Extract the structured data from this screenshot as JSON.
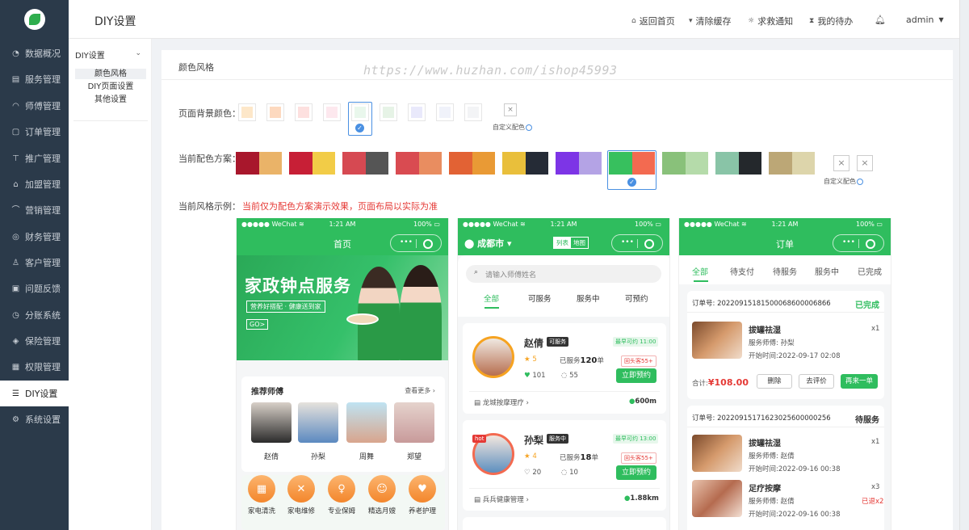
{
  "app": {
    "title": "DIY设置"
  },
  "header": {
    "links": [
      "返回首页",
      "清除缓存",
      "求救通知",
      "我的待办"
    ],
    "user": "admin",
    "dropdown_icon": "caret-down"
  },
  "sidebar": {
    "items": [
      "数据概况",
      "服务管理",
      "师傅管理",
      "订单管理",
      "推广管理",
      "加盟管理",
      "营销管理",
      "财务管理",
      "客户管理",
      "问题反馈",
      "分账系统",
      "保险管理",
      "权限管理",
      "DIY设置",
      "系统设置"
    ],
    "active": "DIY设置"
  },
  "subnav": {
    "head": "DIY设置",
    "items": [
      "颜色风格",
      "DIY页面设置",
      "其他设置"
    ],
    "active": "颜色风格"
  },
  "main": {
    "section_title": "颜色风格",
    "watermark": "https://www.huzhan.com/ishop45993",
    "bg_label": "页面背景颜色：",
    "bg_colors": [
      "#fde7c9",
      "#fdd9bf",
      "#fde0df",
      "#fde8ee",
      "#e9f7ec",
      "#e6f3e6",
      "#e9e9fb",
      "#f0f2fa",
      "#f3f4f6"
    ],
    "bg_selected_index": 4,
    "custom_label": "自定义配色",
    "scheme_label": "当前配色方案：",
    "schemes": [
      [
        "#a8172c",
        "#eab368"
      ],
      [
        "#c71f36",
        "#f2cc47"
      ],
      [
        "#d64952",
        "#555"
      ],
      [
        "#d94b51",
        "#e98d60"
      ],
      [
        "#e26234",
        "#e99a35"
      ],
      [
        "#e9bf3b",
        "#252b36"
      ],
      [
        "#7d35e6",
        "#b4a3e5"
      ],
      [
        "#37c05e",
        "#f36a50"
      ],
      [
        "#89c17a",
        "#b5dbaa"
      ],
      [
        "#89c4a7",
        "#24282c"
      ],
      [
        "#bca776",
        "#ddd5ab"
      ]
    ],
    "scheme_selected_index": 7,
    "example_label": "当前风格示例：",
    "example_note": "当前仅为配色方案演示效果，页面布局以实际为准"
  },
  "phone1": {
    "status_left": "WeChat",
    "time": "1:21 AM",
    "battery": "100%",
    "title": "首页",
    "banner_title": "家政钟点服务",
    "banner_sub": "营养好搭配 · 健康送到家",
    "banner_go": "GO>",
    "rec_title": "推荐师傅",
    "rec_more": "查看更多",
    "masters": [
      "赵倩",
      "孙梨",
      "周舞",
      "郑望"
    ],
    "categories": [
      "家电清洗",
      "家电维修",
      "专业保姆",
      "精选月嫂",
      "养老护理"
    ]
  },
  "phone2": {
    "status_left": "WeChat",
    "time": "1:21 AM",
    "battery": "100%",
    "city": "成都市",
    "toggle": [
      "列表",
      "地图"
    ],
    "search_placeholder": "请输入师傅姓名",
    "tabs": [
      "全部",
      "可服务",
      "服务中",
      "可预约"
    ],
    "masters": [
      {
        "name": "赵倩",
        "status": "可服务",
        "earliest": "最早可约 11:00",
        "rating": "5",
        "served_pre": "已服务",
        "served": "120",
        "unit": "单",
        "repeat": "回头客55+",
        "likes": "101",
        "comments": "55",
        "btn": "立即预约",
        "shop": "龙城按摩理疗",
        "dist": "600m"
      },
      {
        "name": "孙梨",
        "status": "服务中",
        "earliest": "最早可约 13:00",
        "rating": "4",
        "served_pre": "已服务",
        "served": "18",
        "unit": "单",
        "repeat": "回头客55+",
        "likes": "20",
        "comments": "10",
        "btn": "立即预约",
        "shop": "兵兵健康管理",
        "dist": "1.88km",
        "tag": "hot"
      }
    ]
  },
  "phone3": {
    "status_left": "WeChat",
    "time": "1:21 AM",
    "battery": "100%",
    "title": "订单",
    "tabs": [
      "全部",
      "待支付",
      "待服务",
      "服务中",
      "已完成"
    ],
    "orders": [
      {
        "no": "订单号: 20220915181500068600006866",
        "state": "已完成",
        "items": [
          {
            "name": "拔罐祛湿",
            "qty": "x1",
            "master_label": "服务师傅:",
            "master": "孙梨",
            "time_label": "开始时间:",
            "time": "2022-09-17 02:08"
          }
        ],
        "total_label": "合计:",
        "total": "¥108.00",
        "buttons": [
          "删除",
          "去评价",
          "再来一单"
        ]
      },
      {
        "no": "订单号: 20220915171623025600000256",
        "state": "待服务",
        "items": [
          {
            "name": "拔罐祛湿",
            "qty": "x1",
            "master_label": "服务师傅:",
            "master": "赵倩",
            "time_label": "开始时间:",
            "time": "2022-09-16 00:38"
          },
          {
            "name": "足疗按摩",
            "qty": "x3",
            "master_label": "服务师傅:",
            "master": "赵倩",
            "time_label": "开始时间:",
            "time": "2022-09-16 00:38",
            "extra": "已退x2"
          }
        ]
      }
    ]
  }
}
